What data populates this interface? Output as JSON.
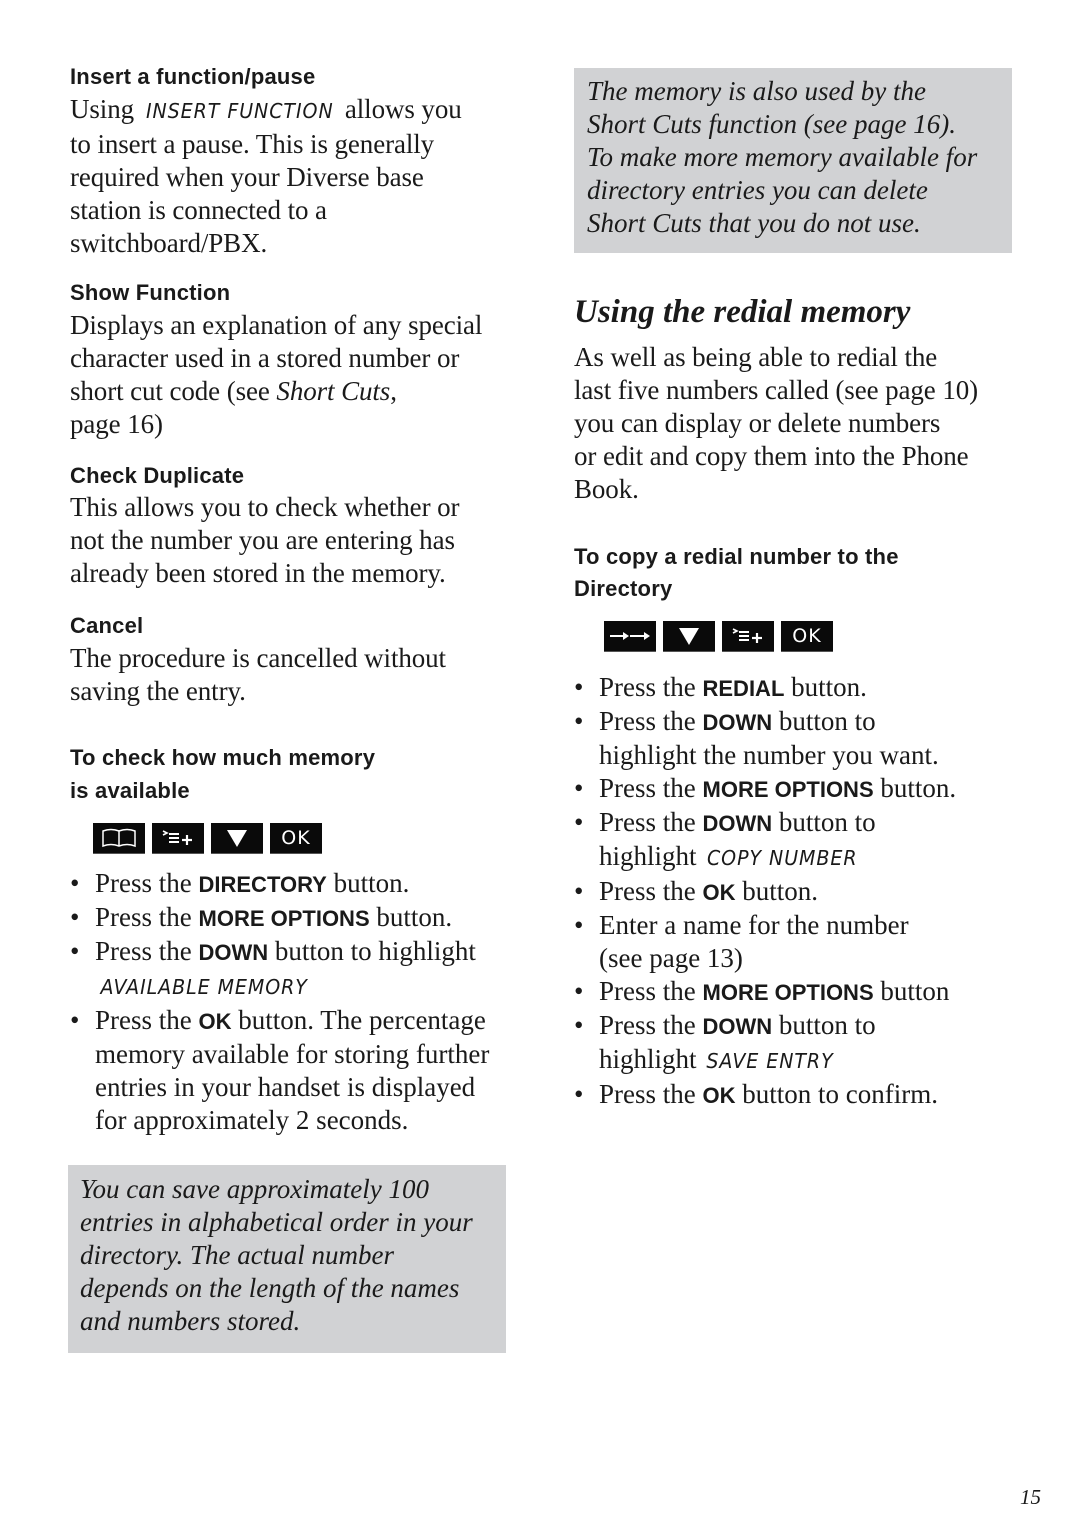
{
  "left": {
    "insert": {
      "heading": "Insert a function/pause",
      "text_pre": "Using ",
      "lcd": "INSERT FUNCTION",
      "text_post_line1": " allows you",
      "lines": [
        "to insert a pause. This is generally",
        "required when your Diverse base",
        "station is connected to a",
        "switchboard/PBX."
      ]
    },
    "show": {
      "heading": "Show Function",
      "line1": "Displays an explanation of any special",
      "line2": "character used in a stored number or",
      "line3_pre": "short cut code (see ",
      "line3_em": "Short Cuts",
      "line3_post": ",",
      "line4": "page 16)"
    },
    "check": {
      "heading": "Check Duplicate",
      "lines": [
        "This allows you to check whether or",
        "not the number you are entering has",
        "already been stored in the memory."
      ]
    },
    "cancel": {
      "heading": "Cancel",
      "lines": [
        "The procedure is cancelled without",
        "saving the entry."
      ]
    },
    "memory": {
      "heading_line1": "To check how much memory",
      "heading_line2": "is available",
      "keys": [
        {
          "icon": "book-icon"
        },
        {
          "icon": "more-options-icon"
        },
        {
          "icon": "down-arrow-icon"
        },
        {
          "icon": "ok-key",
          "label": "OK"
        }
      ],
      "steps": [
        {
          "pre": "Press the ",
          "key": "DIRECTORY",
          "post": " button."
        },
        {
          "pre": "Press the ",
          "key": "MORE OPTIONS",
          "post": " button."
        },
        {
          "pre": "Press the ",
          "key": "DOWN",
          "post": " button to highlight",
          "lcd": "AVAILABLE MEMORY"
        },
        {
          "pre": "Press the ",
          "key": "OK",
          "post": " button. The percentage",
          "cont": [
            "memory available for storing further",
            "entries in your handset is displayed",
            "for approximately 2 seconds."
          ]
        }
      ]
    },
    "note": {
      "lines": [
        "You can save approximately 100",
        "entries in alphabetical order in your",
        "directory. The actual number",
        "depends on the length of the names",
        "and numbers stored."
      ]
    }
  },
  "right": {
    "note": {
      "lines": [
        "The memory is also used by the",
        "Short Cuts function (see page 16).",
        "To make more memory available for",
        "directory entries you can delete",
        "Short Cuts that you do not use."
      ]
    },
    "redial": {
      "title": "Using the redial memory",
      "lines": [
        "As well as being able to redial the",
        "last five numbers called (see page 10)",
        "you can display or delete numbers",
        "or edit and copy them into the Phone",
        "Book."
      ]
    },
    "copy": {
      "heading_line1": "To copy a redial number to the",
      "heading_line2": "Directory",
      "keys": [
        {
          "icon": "redial-icon"
        },
        {
          "icon": "down-arrow-icon"
        },
        {
          "icon": "more-options-icon"
        },
        {
          "icon": "ok-key",
          "label": "OK"
        }
      ],
      "steps": [
        {
          "pre": "Press the ",
          "key": "REDIAL",
          "post": " button."
        },
        {
          "pre": "Press the ",
          "key": "DOWN",
          "post": " button to",
          "cont_text": "highlight the number you want."
        },
        {
          "pre": "Press the ",
          "key": "MORE OPTIONS",
          "post": " button."
        },
        {
          "pre": "Press the ",
          "key": "DOWN",
          "post": " button to",
          "cont_pre": "highlight ",
          "lcd": "COPY NUMBER"
        },
        {
          "pre": "Press the ",
          "key": "OK",
          "post": " button."
        },
        {
          "pre": "Enter a name for the number",
          "cont_text": "(see page 13)"
        },
        {
          "pre": "Press the ",
          "key": "MORE OPTIONS",
          "post": " button"
        },
        {
          "pre": "Press the ",
          "key": "DOWN",
          "post": " button to",
          "cont_pre": "highlight ",
          "lcd": "SAVE ENTRY"
        },
        {
          "pre": "Press the ",
          "key": "OK",
          "post": " button to confirm."
        }
      ]
    }
  },
  "page_number": "15"
}
